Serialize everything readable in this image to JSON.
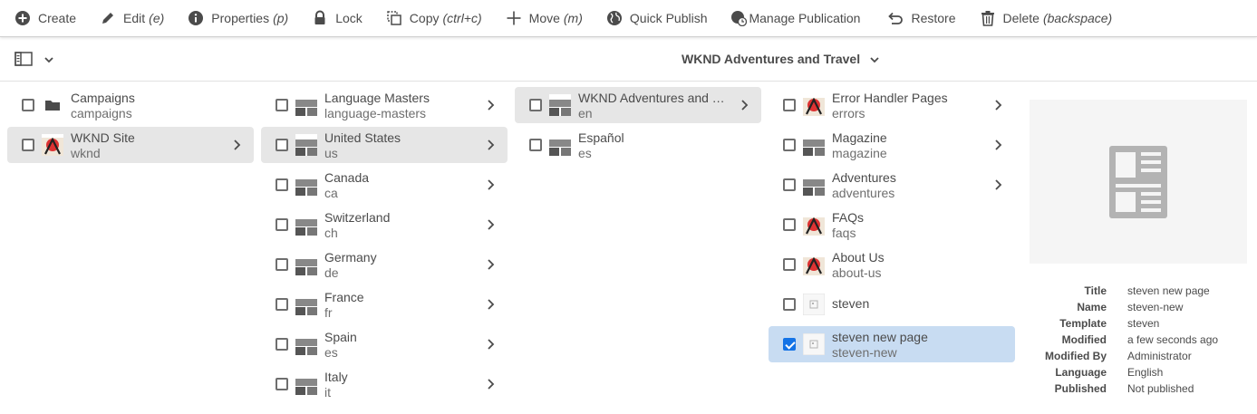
{
  "toolbar": {
    "create": {
      "label": "Create",
      "hint": ""
    },
    "edit": {
      "label": "Edit",
      "hint": "(e)"
    },
    "properties": {
      "label": "Properties",
      "hint": "(p)"
    },
    "lock": {
      "label": "Lock",
      "hint": ""
    },
    "copy": {
      "label": "Copy",
      "hint": "(ctrl+c)"
    },
    "move": {
      "label": "Move",
      "hint": "(m)"
    },
    "quick_publish": {
      "label": "Quick Publish",
      "hint": ""
    },
    "manage_publication": {
      "label": "Manage Publication",
      "hint": ""
    },
    "restore": {
      "label": "Restore",
      "hint": ""
    },
    "delete": {
      "label": "Delete",
      "hint": "(backspace)"
    }
  },
  "header": {
    "title": "WKND Adventures and Travel"
  },
  "columns": {
    "col1": [
      {
        "title": "Campaigns",
        "name": "campaigns"
      },
      {
        "title": "WKND Site",
        "name": "wknd"
      }
    ],
    "col2": [
      {
        "title": "Language Masters",
        "name": "language-masters"
      },
      {
        "title": "United States",
        "name": "us"
      },
      {
        "title": "Canada",
        "name": "ca"
      },
      {
        "title": "Switzerland",
        "name": "ch"
      },
      {
        "title": "Germany",
        "name": "de"
      },
      {
        "title": "France",
        "name": "fr"
      },
      {
        "title": "Spain",
        "name": "es"
      },
      {
        "title": "Italy",
        "name": "it"
      }
    ],
    "col3": [
      {
        "title": "WKND Adventures and Travel",
        "name": "en"
      },
      {
        "title": "Español",
        "name": "es"
      }
    ],
    "col4": [
      {
        "title": "Error Handler Pages",
        "name": "errors"
      },
      {
        "title": "Magazine",
        "name": "magazine"
      },
      {
        "title": "Adventures",
        "name": "adventures"
      },
      {
        "title": "FAQs",
        "name": "faqs"
      },
      {
        "title": "About Us",
        "name": "about-us"
      },
      {
        "title": "steven",
        "name": ""
      },
      {
        "title": "steven new page",
        "name": "steven-new"
      }
    ]
  },
  "details": {
    "title_key": "Title",
    "title_val": "steven new page",
    "name_key": "Name",
    "name_val": "steven-new",
    "template_key": "Template",
    "template_val": "steven",
    "modified_key": "Modified",
    "modified_val": "a few seconds ago",
    "modified_by_key": "Modified By",
    "modified_by_val": "Administrator",
    "language_key": "Language",
    "language_val": "English",
    "published_key": "Published",
    "published_val": "Not published"
  },
  "colors": {
    "selected_row": "#c8dcf2",
    "active_row": "#e6e6e6",
    "checkbox_checked": "#1473e6"
  }
}
